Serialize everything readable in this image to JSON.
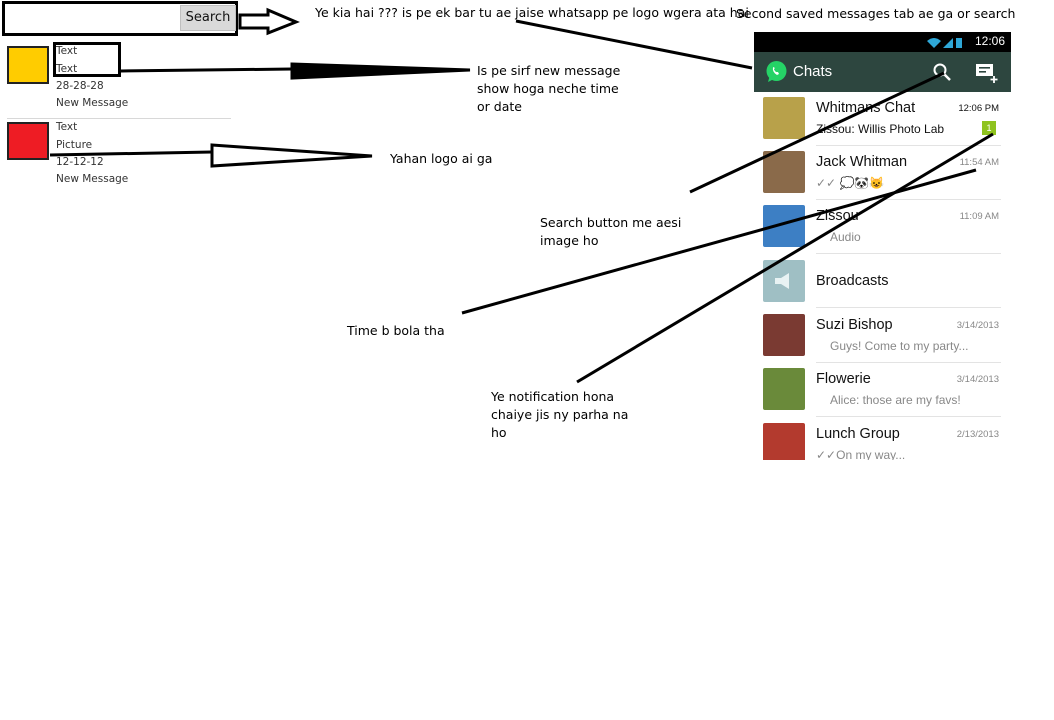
{
  "search": {
    "button_label": "Search"
  },
  "items": [
    {
      "color": "#ffcc00",
      "line1": "Text",
      "line2": "Text",
      "line3": "28-28-28",
      "line4": "New Message"
    },
    {
      "color": "#ee1c24",
      "line1": "Text",
      "line2": "Picture",
      "line3": "12-12-12",
      "line4": "New Message"
    }
  ],
  "notes": {
    "top": "Ye kia hai ??? is pe ek bar tu ae jaise whatsapp pe logo wgera ata hai",
    "top_right": "Second saved messages tab ae ga or search",
    "new_message": "Is pe sirf new message show hoga neche time or date",
    "logo": "Yahan logo ai ga",
    "search_icon": "Search button me aesi image ho",
    "time": "Time b bola tha",
    "notification": "Ye notification hona chaiye jis ny parha na ho"
  },
  "phone": {
    "clock": "12:06",
    "title": "Chats",
    "colors": {
      "appbar": "#2d463f",
      "accent": "#25d366",
      "badge": "#8fc31f"
    },
    "chats": [
      {
        "name": "Whitmans Chat",
        "message": "Zissou: Willis Photo Lab",
        "time": "12:06 PM",
        "unread": "1",
        "avatar_color": "#b8a14a"
      },
      {
        "name": "Jack Whitman",
        "message": "✓✓ 💭🐼😺",
        "time": "11:54 AM",
        "avatar_color": "#8a6a4a"
      },
      {
        "name": "Zissou",
        "message": "Audio",
        "time": "11:09 AM",
        "avatar_color": "#3d7fc4"
      },
      {
        "name": "Broadcasts",
        "message": "",
        "time": "",
        "avatar_color": "#9fbfc4"
      },
      {
        "name": "Suzi Bishop",
        "message": "Guys! Come to my party...",
        "time": "3/14/2013",
        "avatar_color": "#7a3a32"
      },
      {
        "name": "Flowerie",
        "message": "Alice: those are my favs!",
        "time": "3/14/2013",
        "avatar_color": "#6a8a3a"
      },
      {
        "name": "Lunch Group",
        "message": "✓✓On my way...",
        "time": "2/13/2013",
        "avatar_color": "#b33a2e"
      }
    ]
  }
}
